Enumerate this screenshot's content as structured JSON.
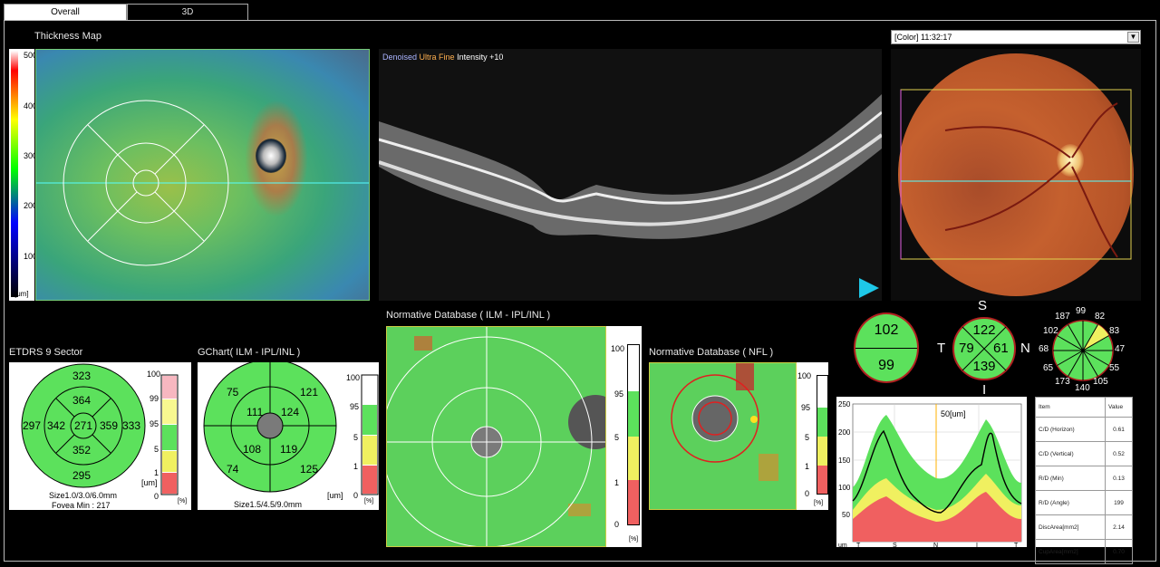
{
  "tabs": [
    {
      "label": "Overall",
      "active": true
    },
    {
      "label": "3D",
      "active": false
    }
  ],
  "thickness_map": {
    "title": "Thickness Map",
    "scale": [
      "500",
      "400",
      "300",
      "200",
      "100"
    ],
    "unit": "[um]"
  },
  "bscan": {
    "denoised": "Denoised",
    "ultra_fine": "Ultra Fine",
    "intensity": "Intensity +10"
  },
  "fundus": {
    "select_value": "[Color]  11:32:17"
  },
  "etdrs": {
    "title": "ETDRS 9 Sector",
    "values": {
      "outer_sup": "323",
      "inner_sup": "364",
      "outer_temp": "297",
      "inner_temp": "342",
      "center": "271",
      "inner_nas": "359",
      "outer_nas": "333",
      "inner_inf": "352",
      "outer_inf": "295"
    },
    "size": "Size1.0/3.0/6.0mm",
    "fovea": "Fovea Min : 217",
    "unit": "[um]"
  },
  "gchart": {
    "title": "GChart( ILM - IPL/INL )",
    "values": {
      "ul": "75",
      "ur": "121",
      "il_u": "111",
      "ir_u": "124",
      "il_d": "108",
      "ir_d": "119",
      "ll": "74",
      "lr": "125"
    },
    "size": "Size1.5/4.5/9.0mm",
    "unit": "[um]"
  },
  "normdb_ganglion": {
    "title": "Normative Database ( ILM - IPL/INL )",
    "scale": [
      "100",
      "95",
      "5",
      "1",
      "0"
    ],
    "unit": "[%]"
  },
  "normdb_nfl": {
    "title": "Normative Database ( NFL )",
    "scale": [
      "100",
      "95",
      "5",
      "1",
      "0"
    ],
    "unit": "[%]"
  },
  "pct_scale": {
    "labels": [
      "100",
      "99",
      "95",
      "5",
      "1",
      "0"
    ],
    "unit": "[%]"
  },
  "pct_scale2": {
    "labels": [
      "100",
      "95",
      "5",
      "1",
      "0"
    ],
    "unit": "[%]"
  },
  "nfl_circle_sup_inf": {
    "top": "102",
    "bottom": "99"
  },
  "nfl_quadrant": {
    "S": "S",
    "T": "T",
    "N": "N",
    "I": "I",
    "top": "122",
    "left": "79",
    "right": "61",
    "bottom": "139"
  },
  "nfl_clock": {
    "values": [
      "99",
      "82",
      "83",
      "47",
      "55",
      "105",
      "140",
      "173",
      "65",
      "68",
      "102",
      "187"
    ]
  },
  "tsnit": {
    "yticks": [
      "250",
      "200",
      "150",
      "100",
      "50"
    ],
    "xticks": [
      "T",
      "S",
      "N",
      "I",
      "T"
    ],
    "unit": "um",
    "annotation": "50[um]"
  },
  "disc_table": {
    "headers": [
      "Item",
      "Value"
    ],
    "rows": [
      {
        "item": "C/D (Horizon)",
        "value": "0.61"
      },
      {
        "item": "C/D (Vertical)",
        "value": "0.52"
      },
      {
        "item": "R/D (Min)",
        "value": "0.13"
      },
      {
        "item": "R/D (Angle)",
        "value": "199"
      },
      {
        "item": "DiscArea[mm2]",
        "value": "2.14"
      },
      {
        "item": "CupArea[mm2]",
        "value": "0.70"
      }
    ]
  },
  "colors": {
    "normal": "#5ce15c",
    "borderline": "#f0f060",
    "abnormal": "#f06060",
    "accent": "#ffb000",
    "arrow": "#1ec8e8"
  }
}
